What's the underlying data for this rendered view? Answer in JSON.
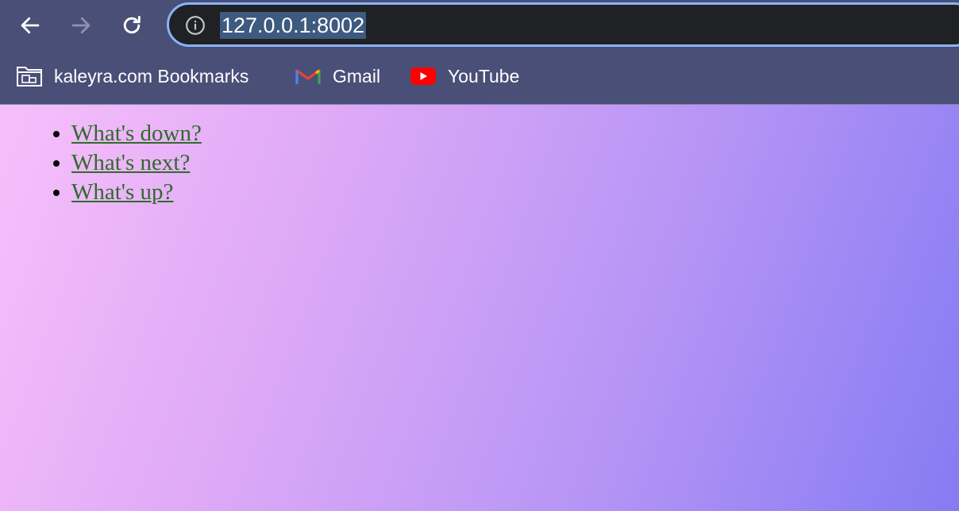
{
  "address_bar": {
    "url": "127.0.0.1:8002"
  },
  "bookmarks": [
    {
      "label": "kaleyra.com Bookmarks",
      "icon": "folder-icon"
    },
    {
      "label": "Gmail",
      "icon": "gmail-icon"
    },
    {
      "label": "YouTube",
      "icon": "youtube-icon"
    }
  ],
  "links": [
    {
      "label": "What's down?"
    },
    {
      "label": "What's next?"
    },
    {
      "label": "What's up?"
    }
  ],
  "colors": {
    "chrome_bg": "#4a4f78",
    "omnibox_border": "#8ab4f8",
    "link": "#2e6b2a",
    "gradient_start": "#f7bffa",
    "gradient_end": "#857bf3"
  }
}
